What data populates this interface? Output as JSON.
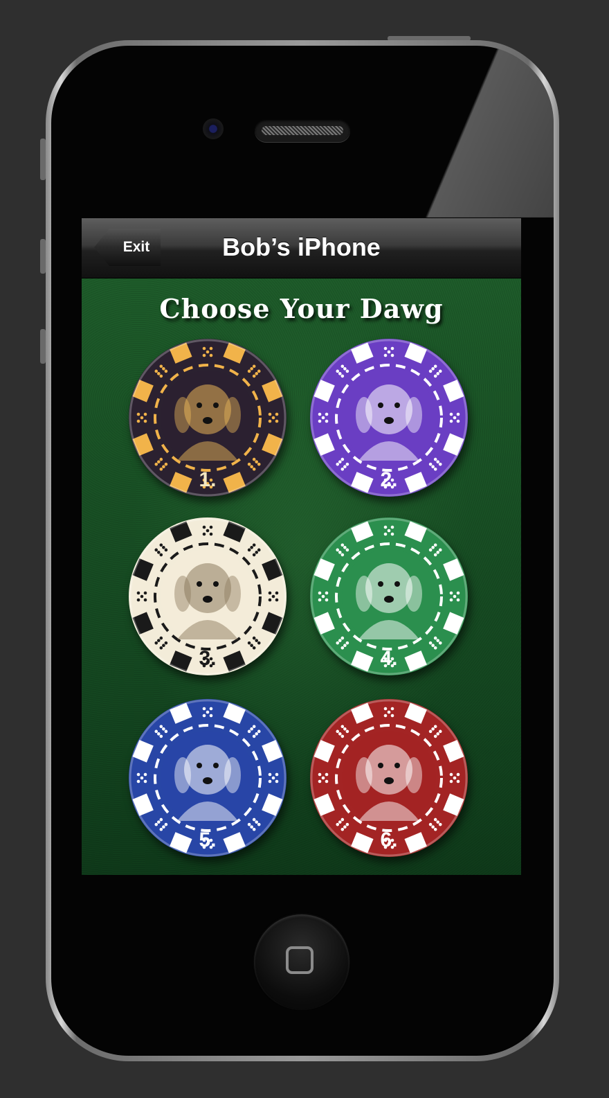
{
  "device": {
    "model": "iPhone 4",
    "home_icon": "square-icon"
  },
  "navbar": {
    "back_label": "Exit",
    "title": "Bob’s iPhone"
  },
  "main": {
    "heading": "Choose Your Dawg",
    "chips": [
      {
        "number": "1.",
        "dog": "pug",
        "chip_color": "#2b2130",
        "accent": "#f1b34a",
        "number_color": "#f3e7c2"
      },
      {
        "number": "2.",
        "dog": "wolf",
        "chip_color": "#6a3ec3",
        "accent": "#ffffff",
        "number_color": "#ffffff"
      },
      {
        "number": "3.",
        "dog": "basset",
        "chip_color": "#f3ecd9",
        "accent": "#1a1a1a",
        "number_color": "#1a1a1a"
      },
      {
        "number": "4.",
        "dog": "sheltie",
        "chip_color": "#2b8f4e",
        "accent": "#ffffff",
        "number_color": "#ffffff"
      },
      {
        "number": "5.",
        "dog": "sheepdog",
        "chip_color": "#2846a6",
        "accent": "#ffffff",
        "number_color": "#ffffff"
      },
      {
        "number": "6.",
        "dog": "collie",
        "chip_color": "#a32424",
        "accent": "#ffffff",
        "number_color": "#ffffff"
      }
    ]
  }
}
